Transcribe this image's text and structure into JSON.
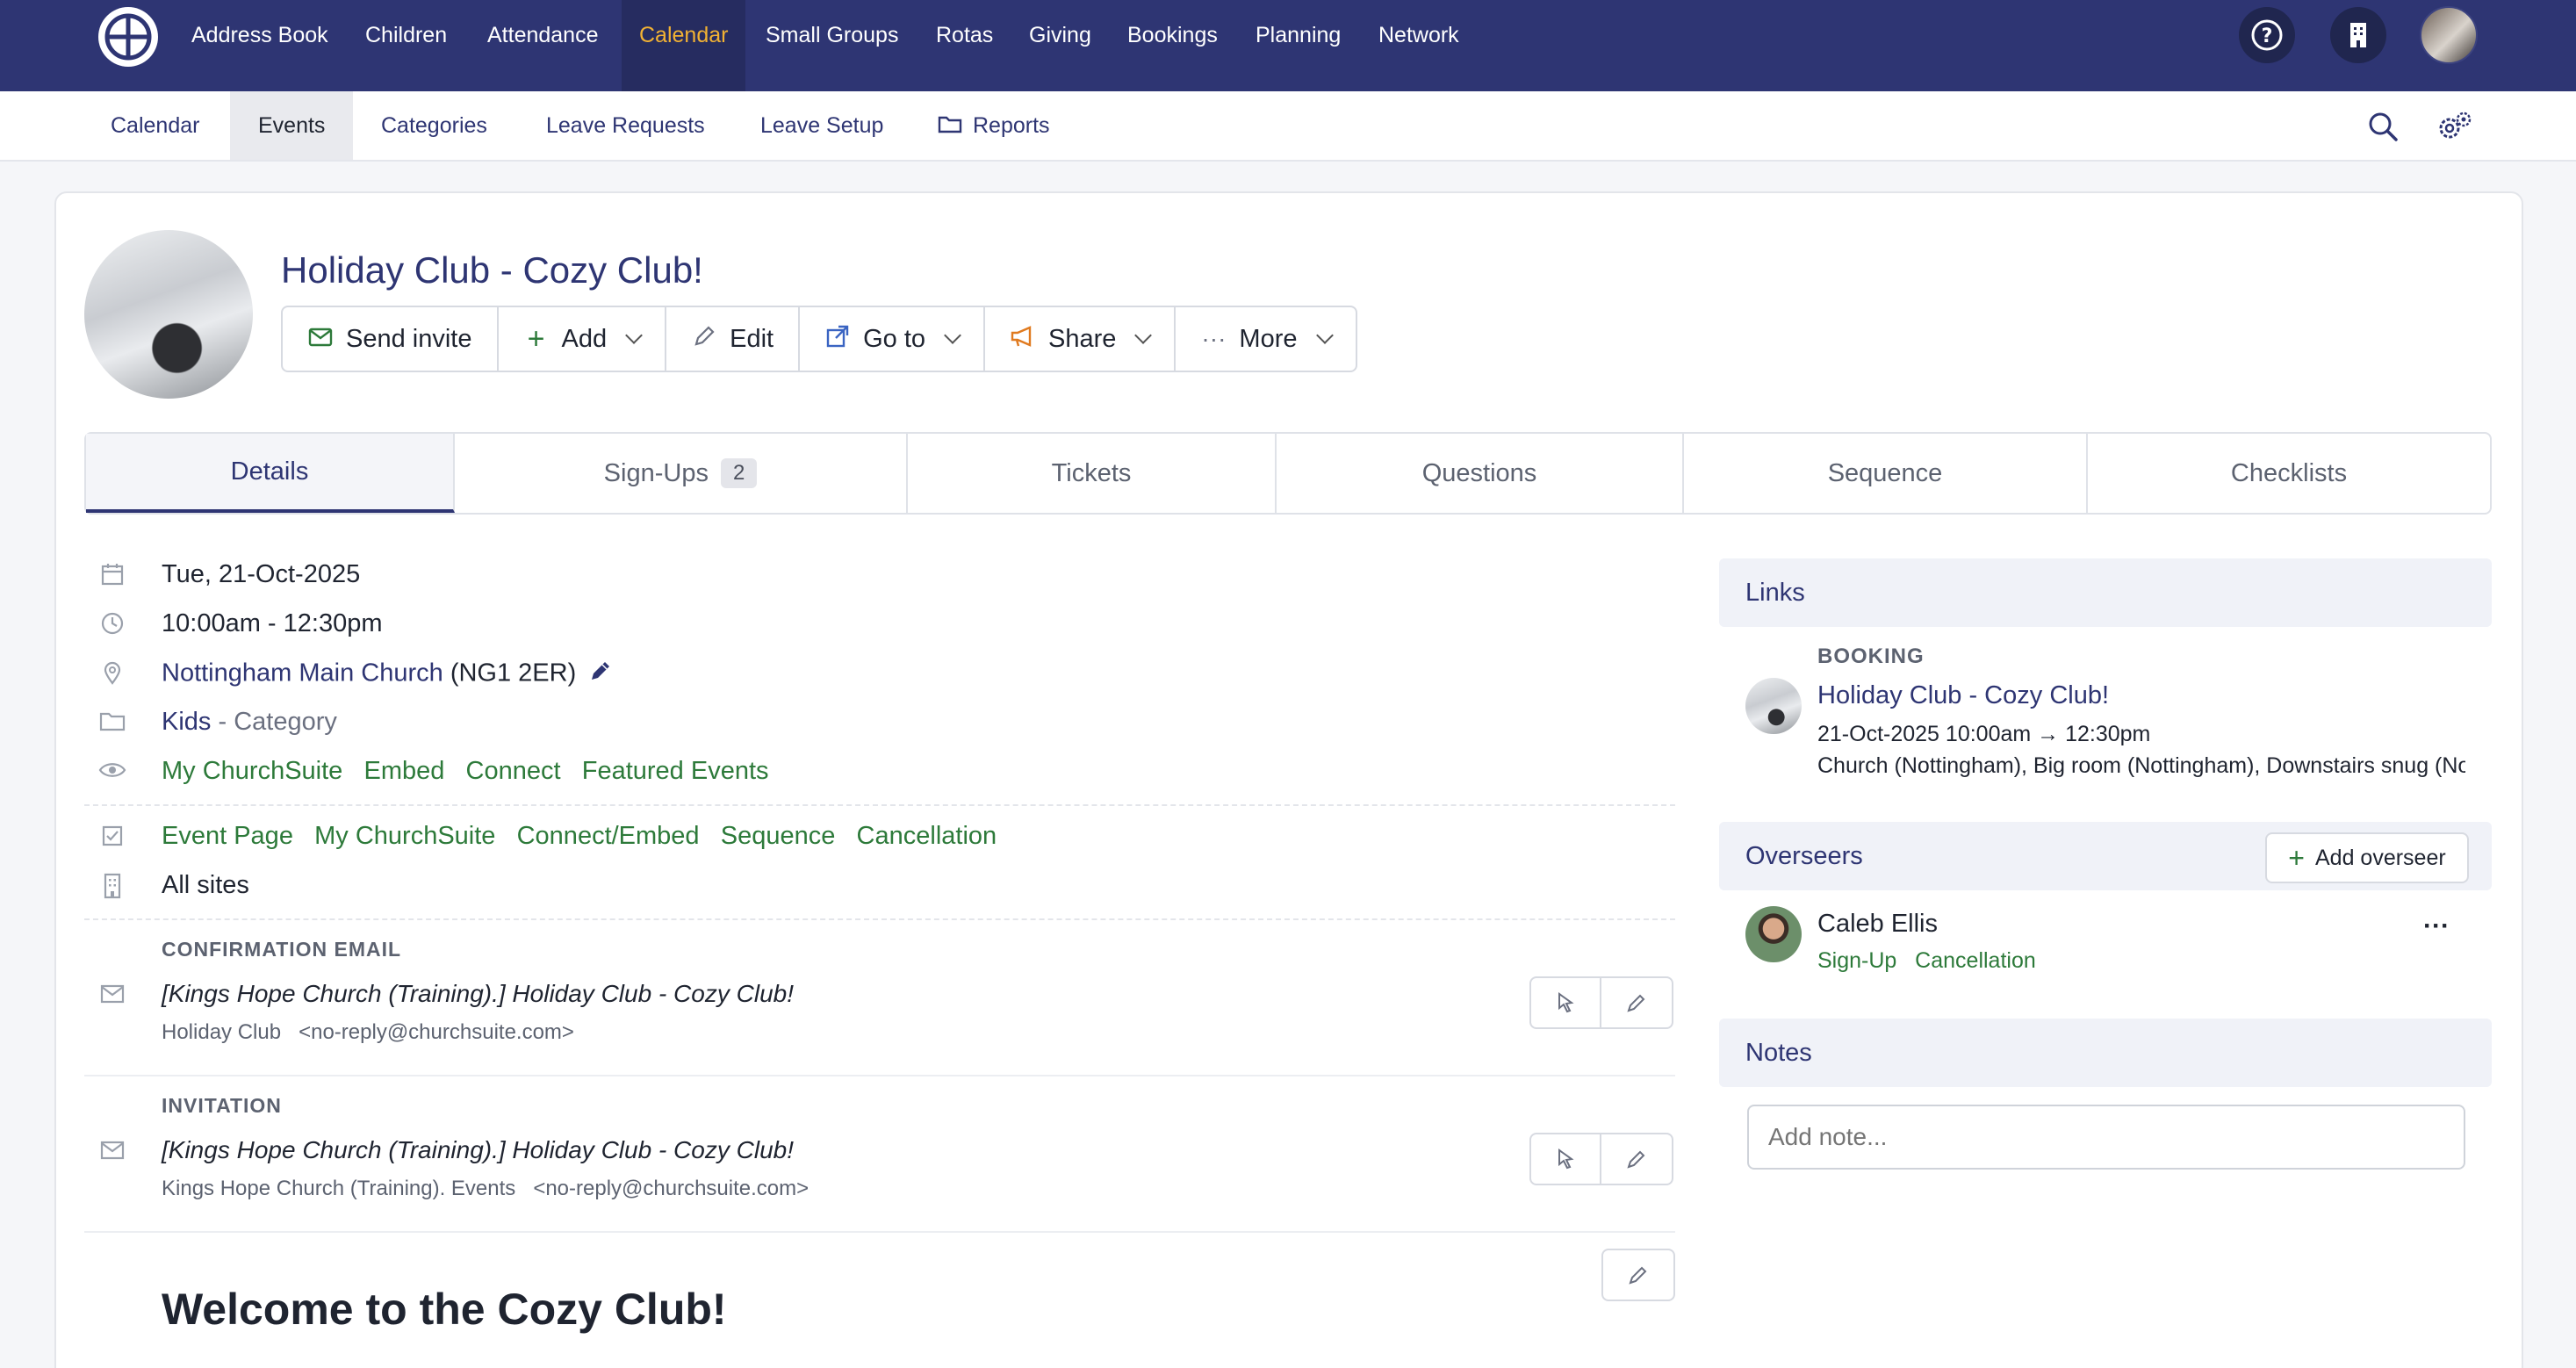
{
  "topnav": {
    "items": [
      "Address Book",
      "Children",
      "Attendance",
      "Calendar",
      "Small Groups",
      "Rotas",
      "Giving",
      "Bookings",
      "Planning",
      "Network"
    ],
    "active": "Calendar",
    "accent": "#f2b233",
    "bg": "#2e3573"
  },
  "subnav": {
    "items": [
      "Calendar",
      "Events",
      "Categories",
      "Leave Requests",
      "Leave Setup",
      "Reports"
    ],
    "active": "Events"
  },
  "event": {
    "title": "Holiday Club - Cozy Club!",
    "actions": {
      "send_invite": "Send invite",
      "add": "Add",
      "edit": "Edit",
      "go_to": "Go to",
      "share": "Share",
      "more": "More"
    }
  },
  "tabs": {
    "details": "Details",
    "signups": "Sign-Ups",
    "signups_count": "2",
    "tickets": "Tickets",
    "questions": "Questions",
    "sequence": "Sequence",
    "checklists": "Checklists"
  },
  "details": {
    "date": "Tue, 21-Oct-2025",
    "time": "10:00am - 12:30pm",
    "location_link": "Nottingham Main Church",
    "location_postcode": "(NG1 2ER)",
    "category": "Kids",
    "category_suffix": "- Category",
    "visibility": [
      "My ChurchSuite",
      "Embed",
      "Connect",
      "Featured Events"
    ],
    "signup_links": [
      "Event Page",
      "My ChurchSuite",
      "Connect/Embed",
      "Sequence",
      "Cancellation"
    ],
    "sites": "All sites"
  },
  "emails": {
    "confirmation": {
      "label": "CONFIRMATION EMAIL",
      "subject": "[Kings Hope Church (Training).] Holiday Club - Cozy Club!",
      "from_name": "Holiday Club",
      "from_email": "<no-reply@churchsuite.com>"
    },
    "invitation": {
      "label": "INVITATION",
      "subject": "[Kings Hope Church (Training).] Holiday Club - Cozy Club!",
      "from_name": "Kings Hope Church (Training). Events",
      "from_email": "<no-reply@churchsuite.com>"
    }
  },
  "description": {
    "heading": "Welcome to the Cozy Club!"
  },
  "links_panel": {
    "title": "Links",
    "booking_label": "BOOKING",
    "booking_title": "Holiday Club - Cozy Club!",
    "booking_time": "21-Oct-2025 10:00am → 12:30pm",
    "booking_resources": "Church (Nottingham), Big room (Nottingham), Downstairs snug (Nottingham)"
  },
  "overseers_panel": {
    "title": "Overseers",
    "add_button": "Add overseer",
    "overseer_name": "Caleb Ellis",
    "overseer_links": [
      "Sign-Up",
      "Cancellation"
    ],
    "menu": "···"
  },
  "notes_panel": {
    "title": "Notes",
    "placeholder": "Add note..."
  },
  "colors": {
    "primary": "#2e3573",
    "link_green": "#2d7a3a"
  }
}
